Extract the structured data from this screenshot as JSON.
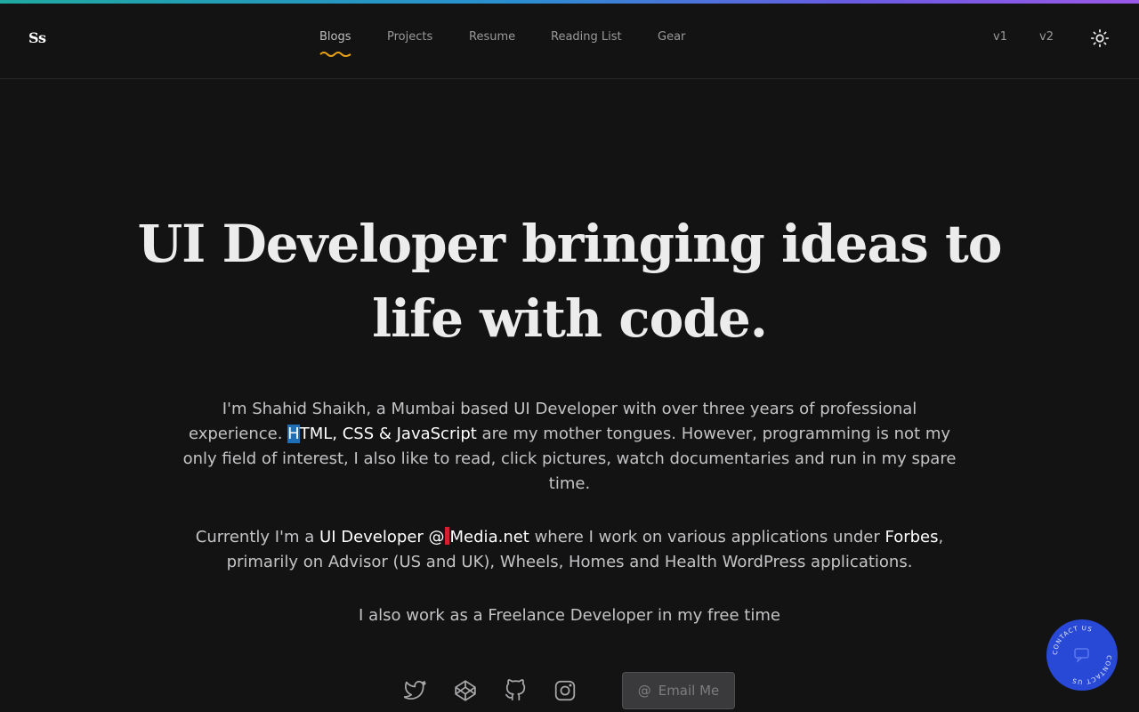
{
  "header": {
    "logo": "Ss",
    "nav": [
      {
        "label": "Blogs",
        "active": true
      },
      {
        "label": "Projects",
        "active": false
      },
      {
        "label": "Resume",
        "active": false
      },
      {
        "label": "Reading List",
        "active": false
      },
      {
        "label": "Gear",
        "active": false
      }
    ],
    "versions": [
      "v1",
      "v2"
    ],
    "theme_icon": "sun-icon"
  },
  "hero": {
    "title": "UI Developer bringing ideas to life with code."
  },
  "intro": {
    "p1_a": "I'm Shahid Shaikh, a Mumbai based UI Developer with over three years of professional experience. ",
    "p1_sel": "H",
    "p1_hl": "TML, CSS & JavaScript",
    "p1_b": " are my mother tongues. However, programming is not my only field of interest, I also like to read, click pictures, watch documentaries and run in my spare time.",
    "p2_a": "Currently I'm a ",
    "p2_role": "UI Developer @",
    "p2_company": "Media.net",
    "p2_b": " where I work on various applications under ",
    "p2_forbes": "Forbes",
    "p2_c": ", primarily on Advisor (US and UK), Wheels, Homes and Health WordPress applications.",
    "p3": "I also work as a Freelance Developer in my free time"
  },
  "social": {
    "icons": [
      "twitter-icon",
      "codepen-icon",
      "github-icon",
      "instagram-icon"
    ],
    "email_icon": "@",
    "email_label": "Email Me"
  },
  "contact_badge": {
    "text": "CONTACT US",
    "icon": "chat-icon"
  },
  "colors": {
    "background": "#131314",
    "accent_squiggle": "#e8a317",
    "badge": "#2848d6",
    "selection": "#1f6fb8",
    "medianet": "#d0212c"
  }
}
